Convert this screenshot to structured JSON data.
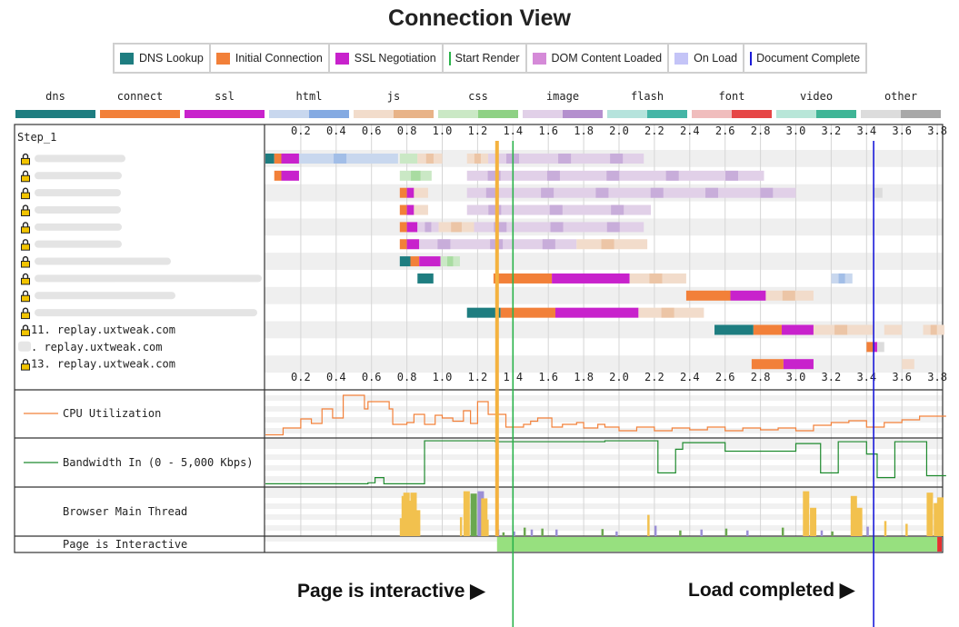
{
  "title": "Connection View",
  "legend": [
    {
      "label": "DNS Lookup",
      "color": "#1e7d80",
      "kind": "box"
    },
    {
      "label": "Initial Connection",
      "color": "#f28039",
      "kind": "box"
    },
    {
      "label": "SSL Negotiation",
      "color": "#c822cc",
      "kind": "box"
    },
    {
      "label": "Start Render",
      "color": "#2bb34b",
      "kind": "line"
    },
    {
      "label": "DOM Content Loaded",
      "color": "#d58ad8",
      "kind": "box"
    },
    {
      "label": "On Load",
      "color": "#c4c4f7",
      "kind": "box"
    },
    {
      "label": "Document Complete",
      "color": "#1a1ad9",
      "kind": "line"
    }
  ],
  "request_types": [
    {
      "label": "dns",
      "colors": [
        "#1e7d80",
        "#1e7d80"
      ]
    },
    {
      "label": "connect",
      "colors": [
        "#f28039",
        "#f28039"
      ]
    },
    {
      "label": "ssl",
      "colors": [
        "#c822cc",
        "#c822cc"
      ]
    },
    {
      "label": "html",
      "colors": [
        "#c8d7ee",
        "#84aae2"
      ]
    },
    {
      "label": "js",
      "colors": [
        "#f2dccb",
        "#e8b388"
      ]
    },
    {
      "label": "css",
      "colors": [
        "#cae8c5",
        "#8ed184"
      ]
    },
    {
      "label": "image",
      "colors": [
        "#e1d0e8",
        "#b48fce"
      ]
    },
    {
      "label": "flash",
      "colors": [
        "#b5e3dc",
        "#44b5a6"
      ]
    },
    {
      "label": "font",
      "colors": [
        "#f0bdbd",
        "#e64646"
      ]
    },
    {
      "label": "video",
      "colors": [
        "#b8e6d8",
        "#3fb596"
      ]
    },
    {
      "label": "other",
      "colors": [
        "#dcdcdc",
        "#a8a8a8"
      ]
    }
  ],
  "step_label": "Step_1",
  "ticks": [
    "0.2",
    "0.4",
    "0.6",
    "0.8",
    "1.0",
    "1.2",
    "1.4",
    "1.6",
    "1.8",
    "2.0",
    "2.2",
    "2.4",
    "2.6",
    "2.8",
    "3.0",
    "3.2",
    "3.4",
    "3.6",
    "3.8"
  ],
  "row_labels": [
    "",
    "",
    "",
    "",
    "",
    "",
    "",
    "",
    "",
    "",
    "11. replay.uxtweak.com",
    ". replay.uxtweak.com",
    "13. replay.uxtweak.com"
  ],
  "metrics": {
    "cpu": "CPU Utilization",
    "bandwidth": "Bandwidth In (0 - 5,000 Kbps)",
    "main_thread": "Browser Main Thread",
    "interactive": "Page is Interactive"
  },
  "callouts": {
    "interactive": "Page is interactive",
    "load": "Load completed"
  },
  "chart_data": {
    "type": "waterfall",
    "x_unit": "seconds",
    "xlim": [
      0,
      3.85
    ],
    "markers": {
      "dom_content_loaded": 1.31,
      "start_render": 1.4,
      "document_complete": 3.44
    },
    "connections": [
      {
        "row": 1,
        "segments": [
          {
            "type": "dns",
            "start": 0.0,
            "end": 0.05
          },
          {
            "type": "connect",
            "start": 0.05,
            "end": 0.09
          },
          {
            "type": "ssl",
            "start": 0.09,
            "end": 0.19
          },
          {
            "type": "html",
            "start": 0.19,
            "end": 0.75
          },
          {
            "type": "css",
            "start": 0.76,
            "end": 0.86
          },
          {
            "type": "js",
            "start": 0.86,
            "end": 1.0
          },
          {
            "type": "js",
            "start": 1.14,
            "end": 1.26
          },
          {
            "type": "image",
            "start": 1.26,
            "end": 2.14
          }
        ]
      },
      {
        "row": 2,
        "segments": [
          {
            "type": "connect",
            "start": 0.05,
            "end": 0.09
          },
          {
            "type": "ssl",
            "start": 0.09,
            "end": 0.19
          },
          {
            "type": "css",
            "start": 0.76,
            "end": 0.94
          },
          {
            "type": "image",
            "start": 1.14,
            "end": 2.82
          }
        ]
      },
      {
        "row": 3,
        "segments": [
          {
            "type": "connect",
            "start": 0.76,
            "end": 0.8
          },
          {
            "type": "ssl",
            "start": 0.8,
            "end": 0.84
          },
          {
            "type": "js",
            "start": 0.84,
            "end": 0.92
          },
          {
            "type": "image",
            "start": 1.14,
            "end": 3.0
          },
          {
            "type": "other",
            "start": 3.44,
            "end": 3.49
          }
        ]
      },
      {
        "row": 4,
        "segments": [
          {
            "type": "connect",
            "start": 0.76,
            "end": 0.8
          },
          {
            "type": "ssl",
            "start": 0.8,
            "end": 0.84
          },
          {
            "type": "js",
            "start": 0.84,
            "end": 0.92
          },
          {
            "type": "image",
            "start": 1.14,
            "end": 2.18
          }
        ]
      },
      {
        "row": 5,
        "segments": [
          {
            "type": "connect",
            "start": 0.76,
            "end": 0.8
          },
          {
            "type": "ssl",
            "start": 0.8,
            "end": 0.86
          },
          {
            "type": "image",
            "start": 0.86,
            "end": 0.98
          },
          {
            "type": "js",
            "start": 0.98,
            "end": 1.18
          },
          {
            "type": "image",
            "start": 1.18,
            "end": 2.14
          }
        ]
      },
      {
        "row": 6,
        "segments": [
          {
            "type": "connect",
            "start": 0.76,
            "end": 0.8
          },
          {
            "type": "ssl",
            "start": 0.8,
            "end": 0.87
          },
          {
            "type": "image",
            "start": 0.87,
            "end": 1.76
          },
          {
            "type": "js",
            "start": 1.76,
            "end": 2.16
          }
        ]
      },
      {
        "row": 7,
        "segments": [
          {
            "type": "dns",
            "start": 0.76,
            "end": 0.82
          },
          {
            "type": "connect",
            "start": 0.82,
            "end": 0.87
          },
          {
            "type": "ssl",
            "start": 0.87,
            "end": 0.99
          },
          {
            "type": "css",
            "start": 0.99,
            "end": 1.1
          }
        ]
      },
      {
        "row": 8,
        "segments": [
          {
            "type": "dns",
            "start": 0.86,
            "end": 0.95
          },
          {
            "type": "connect",
            "start": 1.29,
            "end": 1.62
          },
          {
            "type": "ssl",
            "start": 1.62,
            "end": 2.06
          },
          {
            "type": "js",
            "start": 2.06,
            "end": 2.38
          },
          {
            "type": "html",
            "start": 3.2,
            "end": 3.32
          }
        ]
      },
      {
        "row": 9,
        "segments": [
          {
            "type": "connect",
            "start": 2.38,
            "end": 2.63
          },
          {
            "type": "ssl",
            "start": 2.63,
            "end": 2.83
          },
          {
            "type": "js",
            "start": 2.83,
            "end": 3.1
          }
        ]
      },
      {
        "row": 10,
        "segments": [
          {
            "type": "dns",
            "start": 1.14,
            "end": 1.33
          },
          {
            "type": "connect",
            "start": 1.33,
            "end": 1.64
          },
          {
            "type": "ssl",
            "start": 1.64,
            "end": 2.11
          },
          {
            "type": "js",
            "start": 2.11,
            "end": 2.48
          }
        ]
      },
      {
        "row": 11,
        "segments": [
          {
            "type": "dns",
            "start": 2.54,
            "end": 2.76
          },
          {
            "type": "connect",
            "start": 2.76,
            "end": 2.92
          },
          {
            "type": "ssl",
            "start": 2.92,
            "end": 3.1
          },
          {
            "type": "js",
            "start": 3.1,
            "end": 3.44
          },
          {
            "type": "js",
            "start": 3.5,
            "end": 3.6
          },
          {
            "type": "js",
            "start": 3.72,
            "end": 3.84
          }
        ]
      },
      {
        "row": 12,
        "segments": [
          {
            "type": "connect",
            "start": 3.4,
            "end": 3.44
          },
          {
            "type": "ssl",
            "start": 3.44,
            "end": 3.46
          },
          {
            "type": "other",
            "start": 3.46,
            "end": 3.5
          }
        ]
      },
      {
        "row": 13,
        "segments": [
          {
            "type": "connect",
            "start": 2.75,
            "end": 2.93
          },
          {
            "type": "ssl",
            "start": 2.93,
            "end": 3.1
          },
          {
            "type": "js",
            "start": 3.6,
            "end": 3.67
          }
        ]
      }
    ],
    "cpu_utilization_percent": [
      [
        0.0,
        5
      ],
      [
        0.1,
        20
      ],
      [
        0.2,
        40
      ],
      [
        0.26,
        30
      ],
      [
        0.32,
        62
      ],
      [
        0.38,
        42
      ],
      [
        0.42,
        42
      ],
      [
        0.44,
        92
      ],
      [
        0.56,
        62
      ],
      [
        0.58,
        78
      ],
      [
        0.7,
        62
      ],
      [
        0.72,
        28
      ],
      [
        0.8,
        32
      ],
      [
        0.84,
        50
      ],
      [
        0.9,
        28
      ],
      [
        0.96,
        48
      ],
      [
        1.0,
        42
      ],
      [
        1.06,
        35
      ],
      [
        1.12,
        58
      ],
      [
        1.16,
        30
      ],
      [
        1.2,
        78
      ],
      [
        1.26,
        50
      ],
      [
        1.36,
        22
      ],
      [
        1.46,
        28
      ],
      [
        1.5,
        35
      ],
      [
        1.54,
        42
      ],
      [
        1.62,
        22
      ],
      [
        1.68,
        28
      ],
      [
        1.76,
        32
      ],
      [
        1.8,
        20
      ],
      [
        1.88,
        28
      ],
      [
        1.92,
        22
      ],
      [
        2.0,
        14
      ],
      [
        2.1,
        22
      ],
      [
        2.2,
        14
      ],
      [
        2.3,
        20
      ],
      [
        2.4,
        16
      ],
      [
        2.5,
        22
      ],
      [
        2.6,
        14
      ],
      [
        2.7,
        20
      ],
      [
        2.8,
        16
      ],
      [
        2.9,
        20
      ],
      [
        3.0,
        14
      ],
      [
        3.1,
        26
      ],
      [
        3.2,
        32
      ],
      [
        3.3,
        36
      ],
      [
        3.4,
        22
      ],
      [
        3.5,
        32
      ],
      [
        3.6,
        38
      ],
      [
        3.7,
        46
      ],
      [
        3.8,
        46
      ],
      [
        3.85,
        46
      ]
    ],
    "bandwidth_in_kbps": [
      [
        0.0,
        350
      ],
      [
        0.58,
        450
      ],
      [
        0.62,
        1000
      ],
      [
        0.67,
        350
      ],
      [
        0.9,
        4900
      ],
      [
        1.26,
        4900
      ],
      [
        1.3,
        4800
      ],
      [
        1.92,
        4900
      ],
      [
        2.22,
        1500
      ],
      [
        2.28,
        1500
      ],
      [
        2.32,
        4000
      ],
      [
        2.36,
        4700
      ],
      [
        2.58,
        4700
      ],
      [
        2.6,
        3800
      ],
      [
        2.98,
        3800
      ],
      [
        3.0,
        4600
      ],
      [
        3.12,
        4600
      ],
      [
        3.14,
        1500
      ],
      [
        3.2,
        1500
      ],
      [
        3.24,
        4800
      ],
      [
        3.36,
        4800
      ],
      [
        3.4,
        3500
      ],
      [
        3.46,
        1000
      ],
      [
        3.52,
        1000
      ],
      [
        3.56,
        4800
      ],
      [
        3.7,
        4800
      ],
      [
        3.74,
        1200
      ],
      [
        3.85,
        1200
      ]
    ],
    "main_thread_activity": [
      [
        0.76,
        38
      ],
      [
        0.77,
        85
      ],
      [
        0.78,
        92
      ],
      [
        0.8,
        75
      ],
      [
        0.82,
        92
      ],
      [
        0.84,
        55
      ],
      [
        0.86,
        25
      ],
      [
        1.1,
        40
      ],
      [
        1.12,
        95
      ],
      [
        1.16,
        90
      ],
      [
        1.2,
        95
      ],
      [
        1.22,
        80
      ],
      [
        1.25,
        35
      ],
      [
        1.31,
        14
      ],
      [
        1.34,
        8
      ],
      [
        1.4,
        10
      ],
      [
        1.46,
        18
      ],
      [
        1.5,
        14
      ],
      [
        1.56,
        16
      ],
      [
        1.64,
        14
      ],
      [
        1.9,
        15
      ],
      [
        1.98,
        10
      ],
      [
        2.16,
        45
      ],
      [
        2.2,
        22
      ],
      [
        2.34,
        12
      ],
      [
        2.46,
        14
      ],
      [
        2.6,
        16
      ],
      [
        2.72,
        12
      ],
      [
        2.92,
        18
      ],
      [
        3.04,
        95
      ],
      [
        3.08,
        60
      ],
      [
        3.14,
        12
      ],
      [
        3.2,
        10
      ],
      [
        3.31,
        85
      ],
      [
        3.34,
        60
      ],
      [
        3.4,
        20
      ],
      [
        3.5,
        32
      ],
      [
        3.62,
        26
      ],
      [
        3.74,
        92
      ],
      [
        3.78,
        70
      ],
      [
        3.8,
        82
      ]
    ],
    "page_interactive": {
      "non_interactive_until": 1.31,
      "interactive_until": 3.8,
      "blocked_after": 3.8
    }
  }
}
